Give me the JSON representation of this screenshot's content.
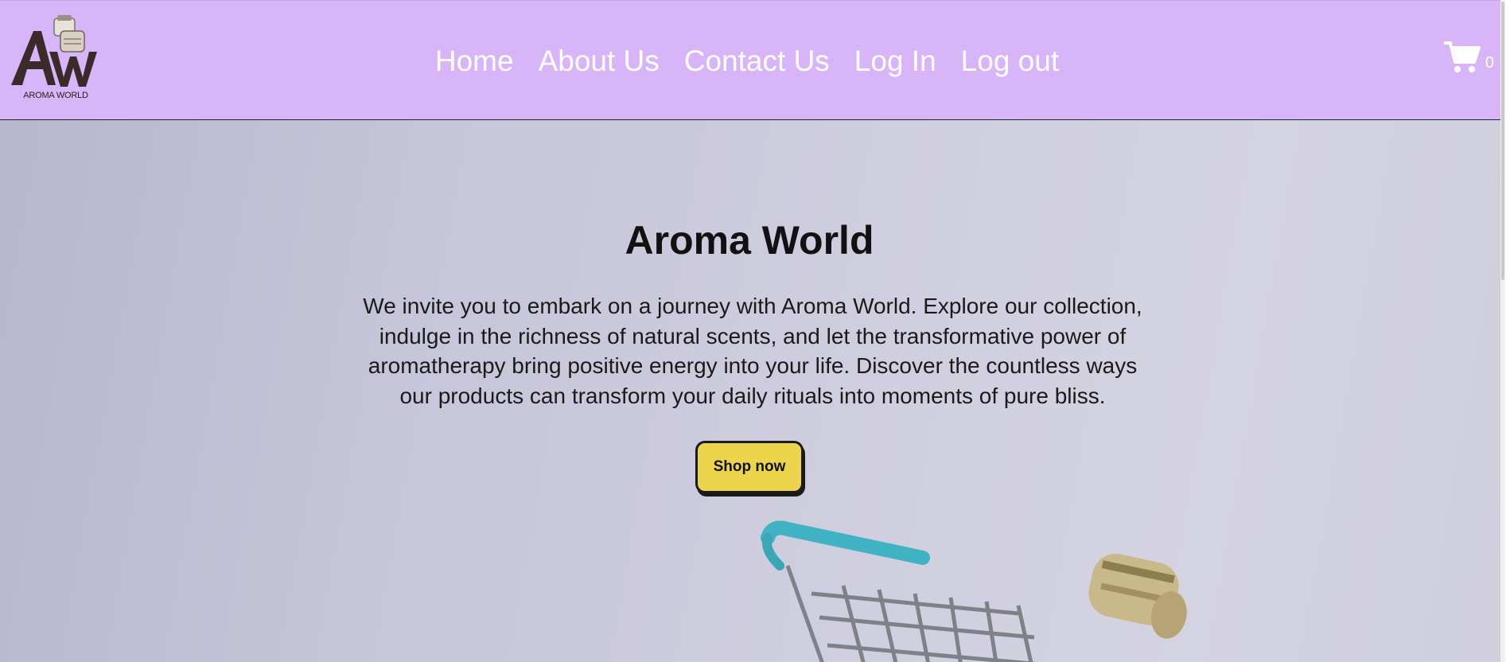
{
  "header": {
    "logo_text": "AROMA WORLD",
    "logo_initials": "AW",
    "nav": [
      {
        "label": "Home"
      },
      {
        "label": "About Us"
      },
      {
        "label": "Contact Us"
      },
      {
        "label": "Log In"
      },
      {
        "label": "Log out"
      }
    ],
    "cart_icon": "shopping-cart-icon",
    "cart_count": "0"
  },
  "hero": {
    "title": "Aroma World",
    "text": "We invite you to embark on a journey with Aroma World. Explore our collection, indulge in the richness of natural scents, and let the transformative power of aromatherapy bring positive energy into your life. Discover the countless ways our products can transform your daily rituals into moments of pure bliss.",
    "cta_label": "Shop now"
  },
  "colors": {
    "header_bg": "#d8b4f8",
    "nav_text": "#ffffff",
    "cta_bg": "#ecd54a",
    "hero_bg": "#c9c8dc"
  }
}
